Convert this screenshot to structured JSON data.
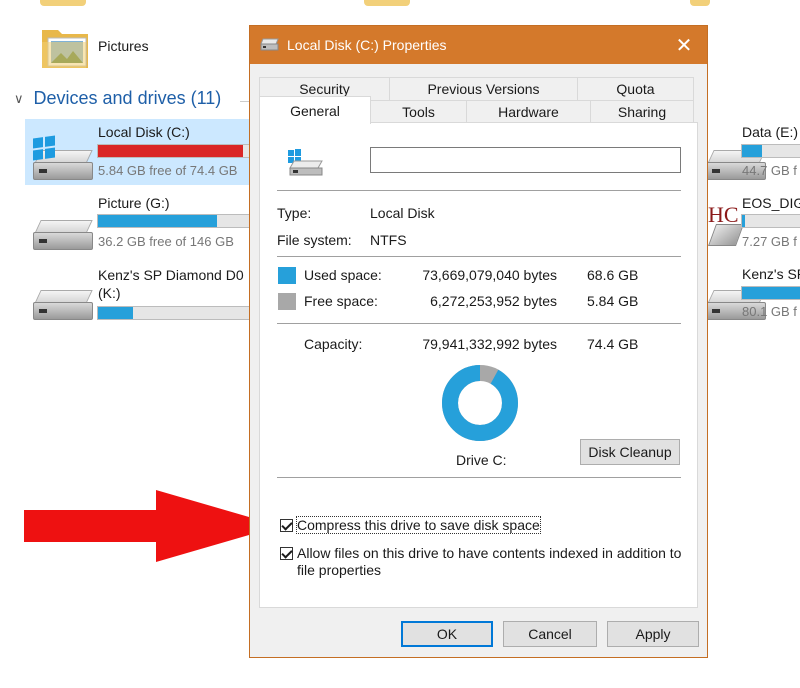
{
  "explorer": {
    "folder_label": "Pictures",
    "group_header": "Devices and drives (11)",
    "drives_left": [
      {
        "name": "Local Disk (C:)",
        "free": "5.84 GB free of 74.4 GB",
        "used_fraction": 0.92,
        "critical": true
      },
      {
        "name": "Picture (G:)",
        "free": "36.2 GB free of 146 GB",
        "used_fraction": 0.75,
        "critical": false
      },
      {
        "name_line1": "Kenz's SP Diamond D0",
        "name_line2": "(K:)",
        "free": "",
        "used_fraction": 0.22,
        "critical": false
      }
    ],
    "drives_right": [
      {
        "name": "Data (E:)",
        "free": "44.7 GB f",
        "used_fraction": 0.3
      },
      {
        "name": "EOS_DIG",
        "sd_badge": "HC",
        "free": "7.27 GB f",
        "used_fraction": 0.05
      },
      {
        "name": "Kenz's SP",
        "free": "80.1 GB f",
        "used_fraction": 0.9
      }
    ]
  },
  "dialog": {
    "title": "Local Disk (C:) Properties",
    "close_glyph": "✕",
    "tabs_row1": [
      "Security",
      "Previous Versions",
      "Quota"
    ],
    "tabs_row2": [
      "General",
      "Tools",
      "Hardware",
      "Sharing"
    ],
    "active_tab": "General",
    "volume_label_value": "",
    "type_label": "Type:",
    "type_value": "Local Disk",
    "fs_label": "File system:",
    "fs_value": "NTFS",
    "used": {
      "label": "Used space:",
      "bytes": "73,669,079,040 bytes",
      "size": "68.6 GB",
      "color": "#26a0da"
    },
    "free": {
      "label": "Free space:",
      "bytes": "6,272,253,952 bytes",
      "size": "5.84 GB",
      "color": "#a8a8a8"
    },
    "capacity": {
      "label": "Capacity:",
      "bytes": "79,941,332,992 bytes",
      "size": "74.4 GB"
    },
    "used_fraction": 0.92,
    "drive_caption": "Drive C:",
    "disk_cleanup_label": "Disk Cleanup",
    "compress_label": "Compress this drive to save disk space",
    "compress_checked": true,
    "index_label_line1": "Allow files on this drive to have contents indexed in addition to",
    "index_label_line2": "file properties",
    "index_checked": true,
    "ok_label": "OK",
    "cancel_label": "Cancel",
    "apply_label": "Apply"
  },
  "colors": {
    "title_bar": "#d4792b",
    "used": "#26a0da",
    "free": "#a8a8a8",
    "critical_bar": "#da2626",
    "arrow": "#ee1111"
  }
}
